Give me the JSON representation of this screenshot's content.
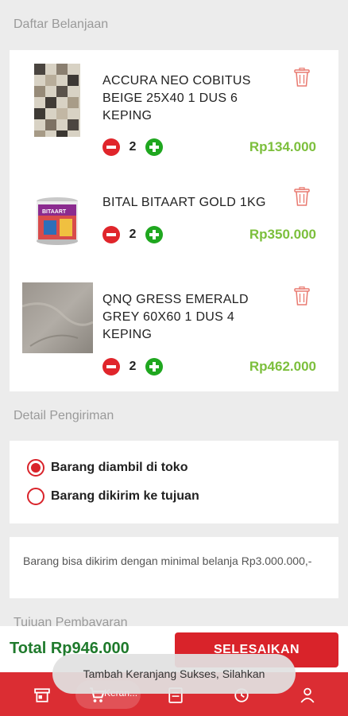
{
  "cart": {
    "section_title": "Daftar Belanjaan",
    "items": [
      {
        "name": "ACCURA NEO COBITUS BEIGE 25X40 1 DUS 6 KEPING",
        "qty": "2",
        "price": "Rp134.000"
      },
      {
        "name": "BITAL BITAART GOLD 1KG",
        "qty": "2",
        "price": "Rp350.000"
      },
      {
        "name": "QNQ GRESS EMERALD GREY 60X60 1 DUS 4 KEPING",
        "qty": "2",
        "price": "Rp462.000"
      }
    ]
  },
  "shipping": {
    "section_title": "Detail Pengiriman",
    "options": [
      {
        "label": "Barang diambil di toko",
        "selected": true
      },
      {
        "label": "Barang dikirim ke tujuan",
        "selected": false
      }
    ],
    "note": "Barang bisa dikirim dengan minimal belanja Rp3.000.000,-"
  },
  "payment": {
    "section_title": "Tujuan Pembayaran"
  },
  "footer": {
    "total": "Total Rp946.000",
    "finish_label": "SELESAIKAN"
  },
  "toast": {
    "message": "Tambah Keranjang Sukses, Silahkan"
  },
  "nav": {
    "items": [
      {
        "icon": "store-icon"
      },
      {
        "icon": "cart-icon",
        "label": "Keran..."
      },
      {
        "icon": "receipt-icon"
      },
      {
        "icon": "history-icon"
      },
      {
        "icon": "user-icon"
      }
    ]
  },
  "colors": {
    "accent": "#d9232a",
    "price": "#7cbf3c",
    "total": "#1f7a2c",
    "add": "#1fa71f"
  }
}
